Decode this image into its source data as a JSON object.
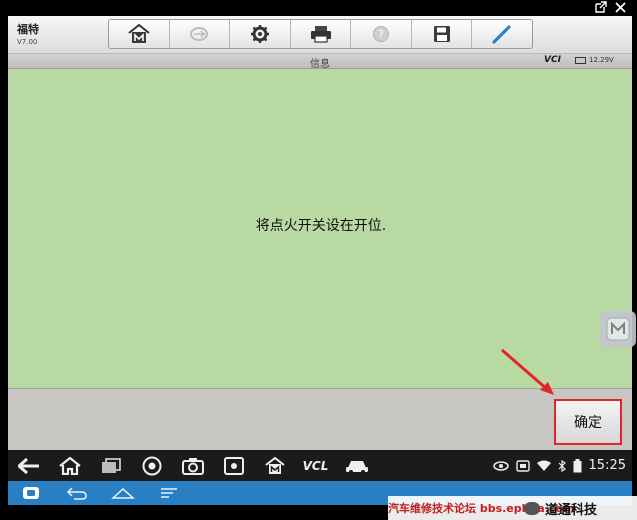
{
  "window": {
    "external_icon": "external-link-icon",
    "close_icon": "close-icon"
  },
  "app": {
    "brand": "福特",
    "version": "V7.00"
  },
  "toolbar": {
    "buttons": [
      {
        "name": "home-icon"
      },
      {
        "name": "vehicle-swap-icon"
      },
      {
        "name": "gear-icon"
      },
      {
        "name": "printer-icon"
      },
      {
        "name": "help-icon"
      },
      {
        "name": "save-icon"
      },
      {
        "name": "pen-icon"
      }
    ]
  },
  "titlebar": {
    "title": "信息",
    "vci": "VCI",
    "battery": "12.29V"
  },
  "message": {
    "text": "将点火开关设在开位."
  },
  "footer": {
    "confirm_label": "确定"
  },
  "android_nav": {
    "vcl": "VCL",
    "clock": "15:25",
    "accent": "#2a7fc2"
  },
  "watermark": {
    "forum": "汽车维修技术论坛 bbs.ephua.com",
    "brand": "道通科技"
  },
  "colors": {
    "message_bg": "#b9d9a3",
    "highlight_border": "#e0262c"
  }
}
